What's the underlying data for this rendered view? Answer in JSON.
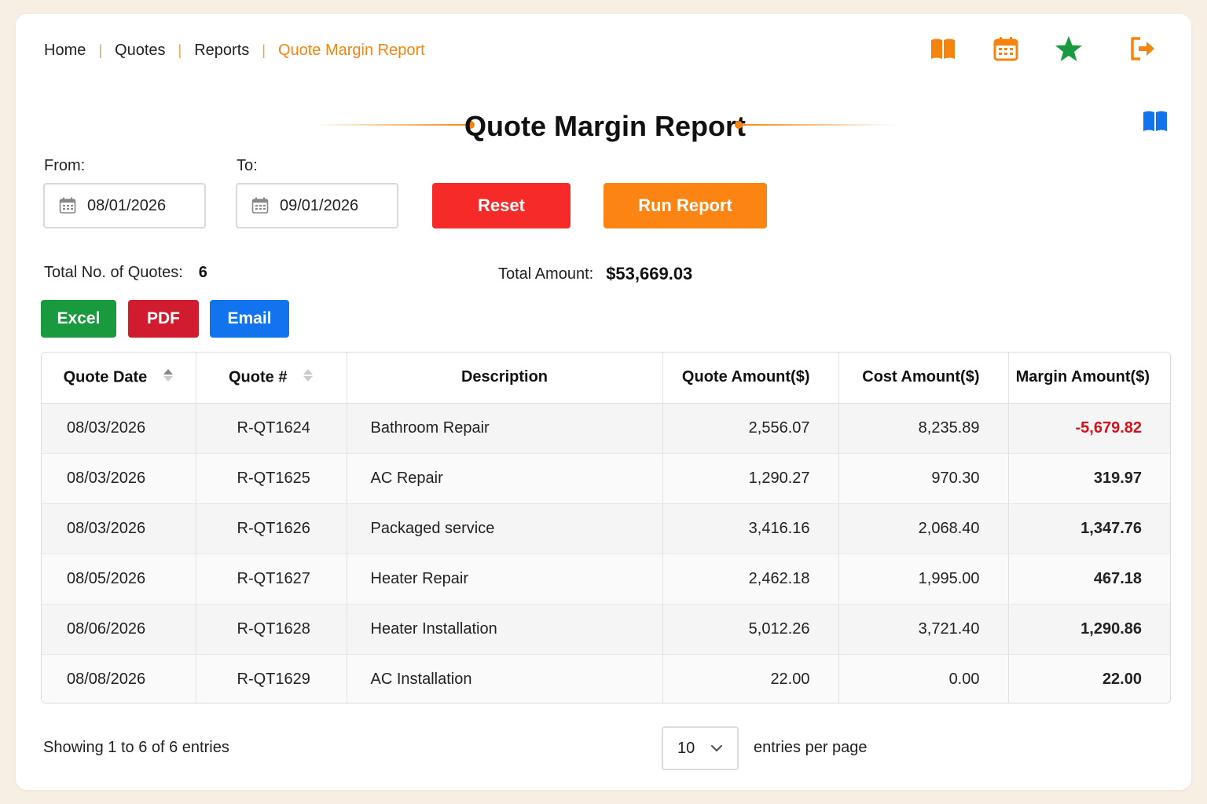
{
  "breadcrumb": {
    "items": [
      "Home",
      "Quotes",
      "Reports"
    ],
    "current": "Quote Margin Report",
    "separator": "|"
  },
  "toolbar_icons": [
    "book-icon",
    "calendar-icon",
    "star-icon",
    "logout-icon"
  ],
  "help_icon": "help-book-icon",
  "page": {
    "title": "Quote Margin Report"
  },
  "filters": {
    "from_label": "From:",
    "from_value": "08/01/2026",
    "to_label": "To:",
    "to_value": "09/01/2026",
    "reset_label": "Reset",
    "run_label": "Run Report"
  },
  "summary": {
    "count_label": "Total No. of Quotes:",
    "count_value": "6",
    "amount_label": "Total Amount:",
    "amount_value": "$53,669.03"
  },
  "export": {
    "excel": "Excel",
    "pdf": "PDF",
    "email": "Email"
  },
  "table": {
    "headers": [
      "Quote Date",
      "Quote #",
      "Description",
      "Quote Amount($)",
      "Cost Amount($)",
      "Margin Amount($)"
    ],
    "rows": [
      [
        "08/03/2026",
        "R-QT1624",
        "Bathroom Repair",
        "2,556.07",
        "8,235.89",
        "-5,679.82"
      ],
      [
        "08/03/2026",
        "R-QT1625",
        "AC Repair",
        "1,290.27",
        "970.30",
        "319.97"
      ],
      [
        "08/03/2026",
        "R-QT1626",
        "Packaged service",
        "3,416.16",
        "2,068.40",
        "1,347.76"
      ],
      [
        "08/05/2026",
        "R-QT1627",
        "Heater Repair",
        "2,462.18",
        "1,995.00",
        "467.18"
      ],
      [
        "08/06/2026",
        "R-QT1628",
        "Heater Installation",
        "5,012.26",
        "3,721.40",
        "1,290.86"
      ],
      [
        "08/08/2026",
        "R-QT1629",
        "AC Installation",
        "22.00",
        "0.00",
        "22.00"
      ]
    ]
  },
  "footer": {
    "showing": "Showing 1 to 6 of 6 entries",
    "page_size": "10",
    "per_page_label": "entries per page"
  },
  "colors": {
    "accent": "#f5840f",
    "reset": "#f72a2a",
    "run": "#fb8413",
    "excel": "#1a9a3e",
    "pdf": "#d01c2e",
    "email": "#1273ee",
    "negative": "#d4111c",
    "star": "#1a9a3e",
    "help": "#1273ee"
  }
}
